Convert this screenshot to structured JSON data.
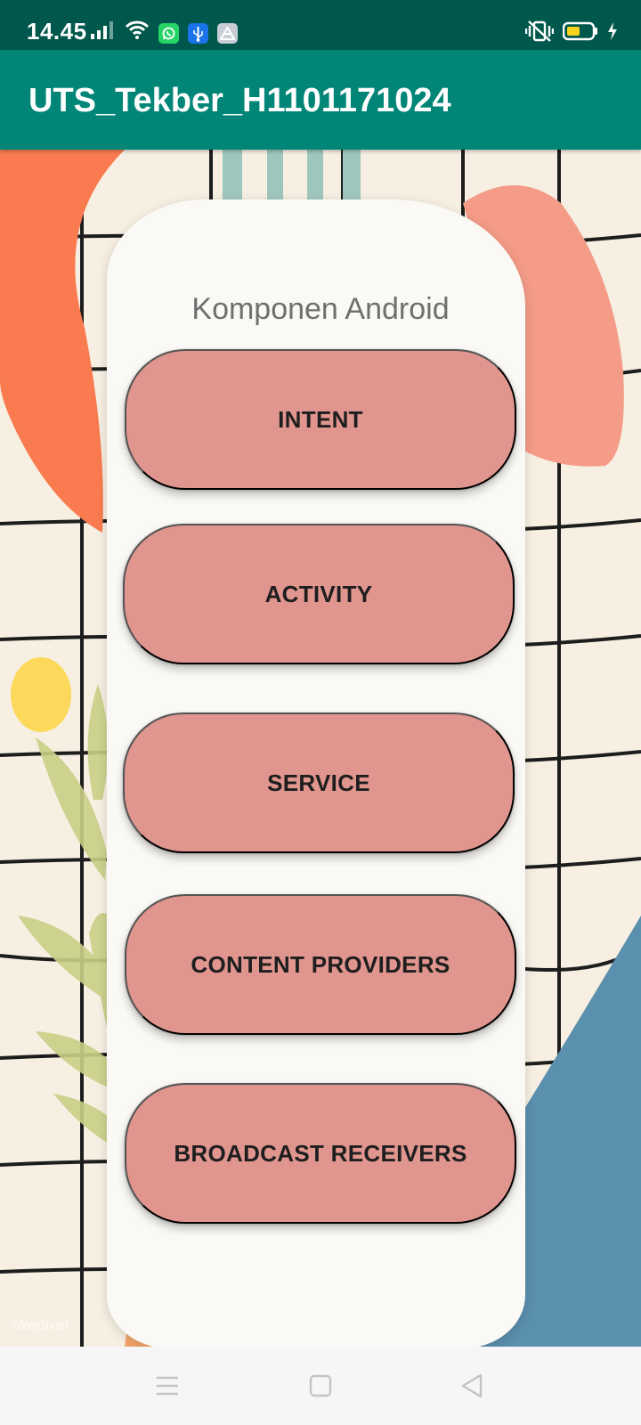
{
  "status_bar": {
    "time": "14.45",
    "icons": [
      "signal-icon",
      "wifi-icon",
      "whatsapp-icon",
      "usb-icon",
      "drive-icon",
      "vibrate-icon",
      "battery-icon",
      "charging-icon"
    ]
  },
  "app_bar": {
    "title": "UTS_Tekber_H1101171024"
  },
  "main": {
    "heading": "Komponen Android",
    "buttons": [
      {
        "label": "INTENT"
      },
      {
        "label": "ACTIVITY"
      },
      {
        "label": "SERVICE"
      },
      {
        "label": "CONTENT PROVIDERS"
      },
      {
        "label": "BROADCAST RECEIVERS"
      }
    ],
    "watermark": "rawpixel"
  },
  "nav_bar": {
    "icons": [
      "menu-icon",
      "home-icon",
      "back-icon"
    ]
  },
  "colors": {
    "status_bar": "#00574b",
    "app_bar": "#008577",
    "button": "#e0958e",
    "background": "#f6efe2"
  }
}
